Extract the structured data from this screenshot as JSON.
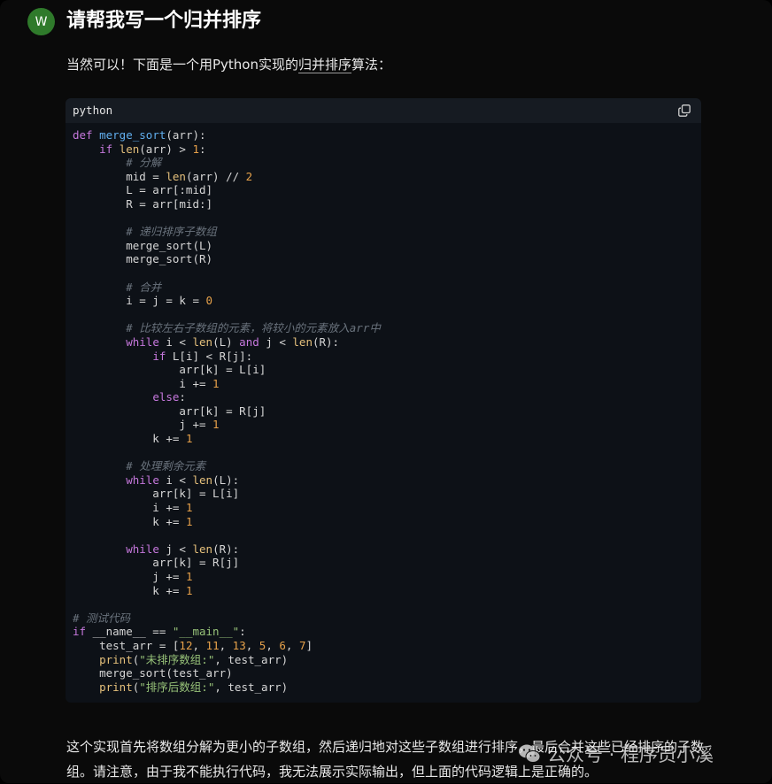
{
  "user": {
    "avatar_letter": "W"
  },
  "question": "请帮我写一个归并排序",
  "answer": {
    "intro_prefix": "当然可以！下面是一个用Python实现的",
    "intro_link": "归并排序",
    "intro_suffix": "算法：",
    "summary": "这个实现首先将数组分解为更小的子数组，然后递归地对这些子数组进行排序，最后合并这些已经排序的子数组。请注意，由于我不能执行代码，我无法展示实际输出，但上面的代码逻辑上是正确的。"
  },
  "code_block": {
    "language": "python",
    "copy_icon": "copy-icon",
    "lines": [
      [
        [
          "kw",
          "def "
        ],
        [
          "fn",
          "merge_sort"
        ],
        [
          "t",
          "(arr):"
        ]
      ],
      [
        [
          "t",
          "    "
        ],
        [
          "kw",
          "if "
        ],
        [
          "bi",
          "len"
        ],
        [
          "t",
          "(arr) > "
        ],
        [
          "num",
          "1"
        ],
        [
          "t",
          ":"
        ]
      ],
      [
        [
          "t",
          "        "
        ],
        [
          "com",
          "# 分解"
        ]
      ],
      [
        [
          "t",
          "        mid = "
        ],
        [
          "bi",
          "len"
        ],
        [
          "t",
          "(arr) // "
        ],
        [
          "num",
          "2"
        ]
      ],
      [
        [
          "t",
          "        L = arr[:mid]"
        ]
      ],
      [
        [
          "t",
          "        R = arr[mid:]"
        ]
      ],
      [],
      [
        [
          "t",
          "        "
        ],
        [
          "com",
          "# 递归排序子数组"
        ]
      ],
      [
        [
          "t",
          "        merge_sort(L)"
        ]
      ],
      [
        [
          "t",
          "        merge_sort(R)"
        ]
      ],
      [],
      [
        [
          "t",
          "        "
        ],
        [
          "com",
          "# 合并"
        ]
      ],
      [
        [
          "t",
          "        i = j = k = "
        ],
        [
          "num",
          "0"
        ]
      ],
      [],
      [
        [
          "t",
          "        "
        ],
        [
          "com",
          "# 比较左右子数组的元素，将较小的元素放入arr中"
        ]
      ],
      [
        [
          "t",
          "        "
        ],
        [
          "kw",
          "while "
        ],
        [
          "t",
          "i < "
        ],
        [
          "bi",
          "len"
        ],
        [
          "t",
          "(L) "
        ],
        [
          "kw",
          "and "
        ],
        [
          "t",
          "j < "
        ],
        [
          "bi",
          "len"
        ],
        [
          "t",
          "(R):"
        ]
      ],
      [
        [
          "t",
          "            "
        ],
        [
          "kw",
          "if "
        ],
        [
          "t",
          "L[i] < R[j]:"
        ]
      ],
      [
        [
          "t",
          "                arr[k] = L[i]"
        ]
      ],
      [
        [
          "t",
          "                i += "
        ],
        [
          "num",
          "1"
        ]
      ],
      [
        [
          "t",
          "            "
        ],
        [
          "kw",
          "else"
        ],
        [
          "t",
          ":"
        ]
      ],
      [
        [
          "t",
          "                arr[k] = R[j]"
        ]
      ],
      [
        [
          "t",
          "                j += "
        ],
        [
          "num",
          "1"
        ]
      ],
      [
        [
          "t",
          "            k += "
        ],
        [
          "num",
          "1"
        ]
      ],
      [],
      [
        [
          "t",
          "        "
        ],
        [
          "com",
          "# 处理剩余元素"
        ]
      ],
      [
        [
          "t",
          "        "
        ],
        [
          "kw",
          "while "
        ],
        [
          "t",
          "i < "
        ],
        [
          "bi",
          "len"
        ],
        [
          "t",
          "(L):"
        ]
      ],
      [
        [
          "t",
          "            arr[k] = L[i]"
        ]
      ],
      [
        [
          "t",
          "            i += "
        ],
        [
          "num",
          "1"
        ]
      ],
      [
        [
          "t",
          "            k += "
        ],
        [
          "num",
          "1"
        ]
      ],
      [],
      [
        [
          "t",
          "        "
        ],
        [
          "kw",
          "while "
        ],
        [
          "t",
          "j < "
        ],
        [
          "bi",
          "len"
        ],
        [
          "t",
          "(R):"
        ]
      ],
      [
        [
          "t",
          "            arr[k] = R[j]"
        ]
      ],
      [
        [
          "t",
          "            j += "
        ],
        [
          "num",
          "1"
        ]
      ],
      [
        [
          "t",
          "            k += "
        ],
        [
          "num",
          "1"
        ]
      ],
      [],
      [
        [
          "com",
          "# 测试代码"
        ]
      ],
      [
        [
          "kw",
          "if "
        ],
        [
          "t",
          "__name__ == "
        ],
        [
          "str",
          "\"__main__\""
        ],
        [
          "t",
          ":"
        ]
      ],
      [
        [
          "t",
          "    test_arr = ["
        ],
        [
          "num",
          "12"
        ],
        [
          "t",
          ", "
        ],
        [
          "num",
          "11"
        ],
        [
          "t",
          ", "
        ],
        [
          "num",
          "13"
        ],
        [
          "t",
          ", "
        ],
        [
          "num",
          "5"
        ],
        [
          "t",
          ", "
        ],
        [
          "num",
          "6"
        ],
        [
          "t",
          ", "
        ],
        [
          "num",
          "7"
        ],
        [
          "t",
          "]"
        ]
      ],
      [
        [
          "t",
          "    "
        ],
        [
          "bi",
          "print"
        ],
        [
          "t",
          "("
        ],
        [
          "str",
          "\"未排序数组:\""
        ],
        [
          "t",
          ", test_arr)"
        ]
      ],
      [
        [
          "t",
          "    merge_sort(test_arr)"
        ]
      ],
      [
        [
          "t",
          "    "
        ],
        [
          "bi",
          "print"
        ],
        [
          "t",
          "("
        ],
        [
          "str",
          "\"排序后数组:\""
        ],
        [
          "t",
          ", test_arr)"
        ]
      ]
    ]
  },
  "watermark": {
    "icon": "wechat-icon",
    "text": "公众号 · 程序员小溪"
  },
  "colors": {
    "background": "#0a0a0a",
    "code_background": "#0d1117",
    "code_header": "#161b22",
    "avatar": "#2f7a2b",
    "keyword": "#c678dd",
    "function": "#61afef",
    "builtin": "#e5c07b",
    "number": "#e6a14a",
    "string": "#98c379",
    "comment": "#6a737d"
  }
}
